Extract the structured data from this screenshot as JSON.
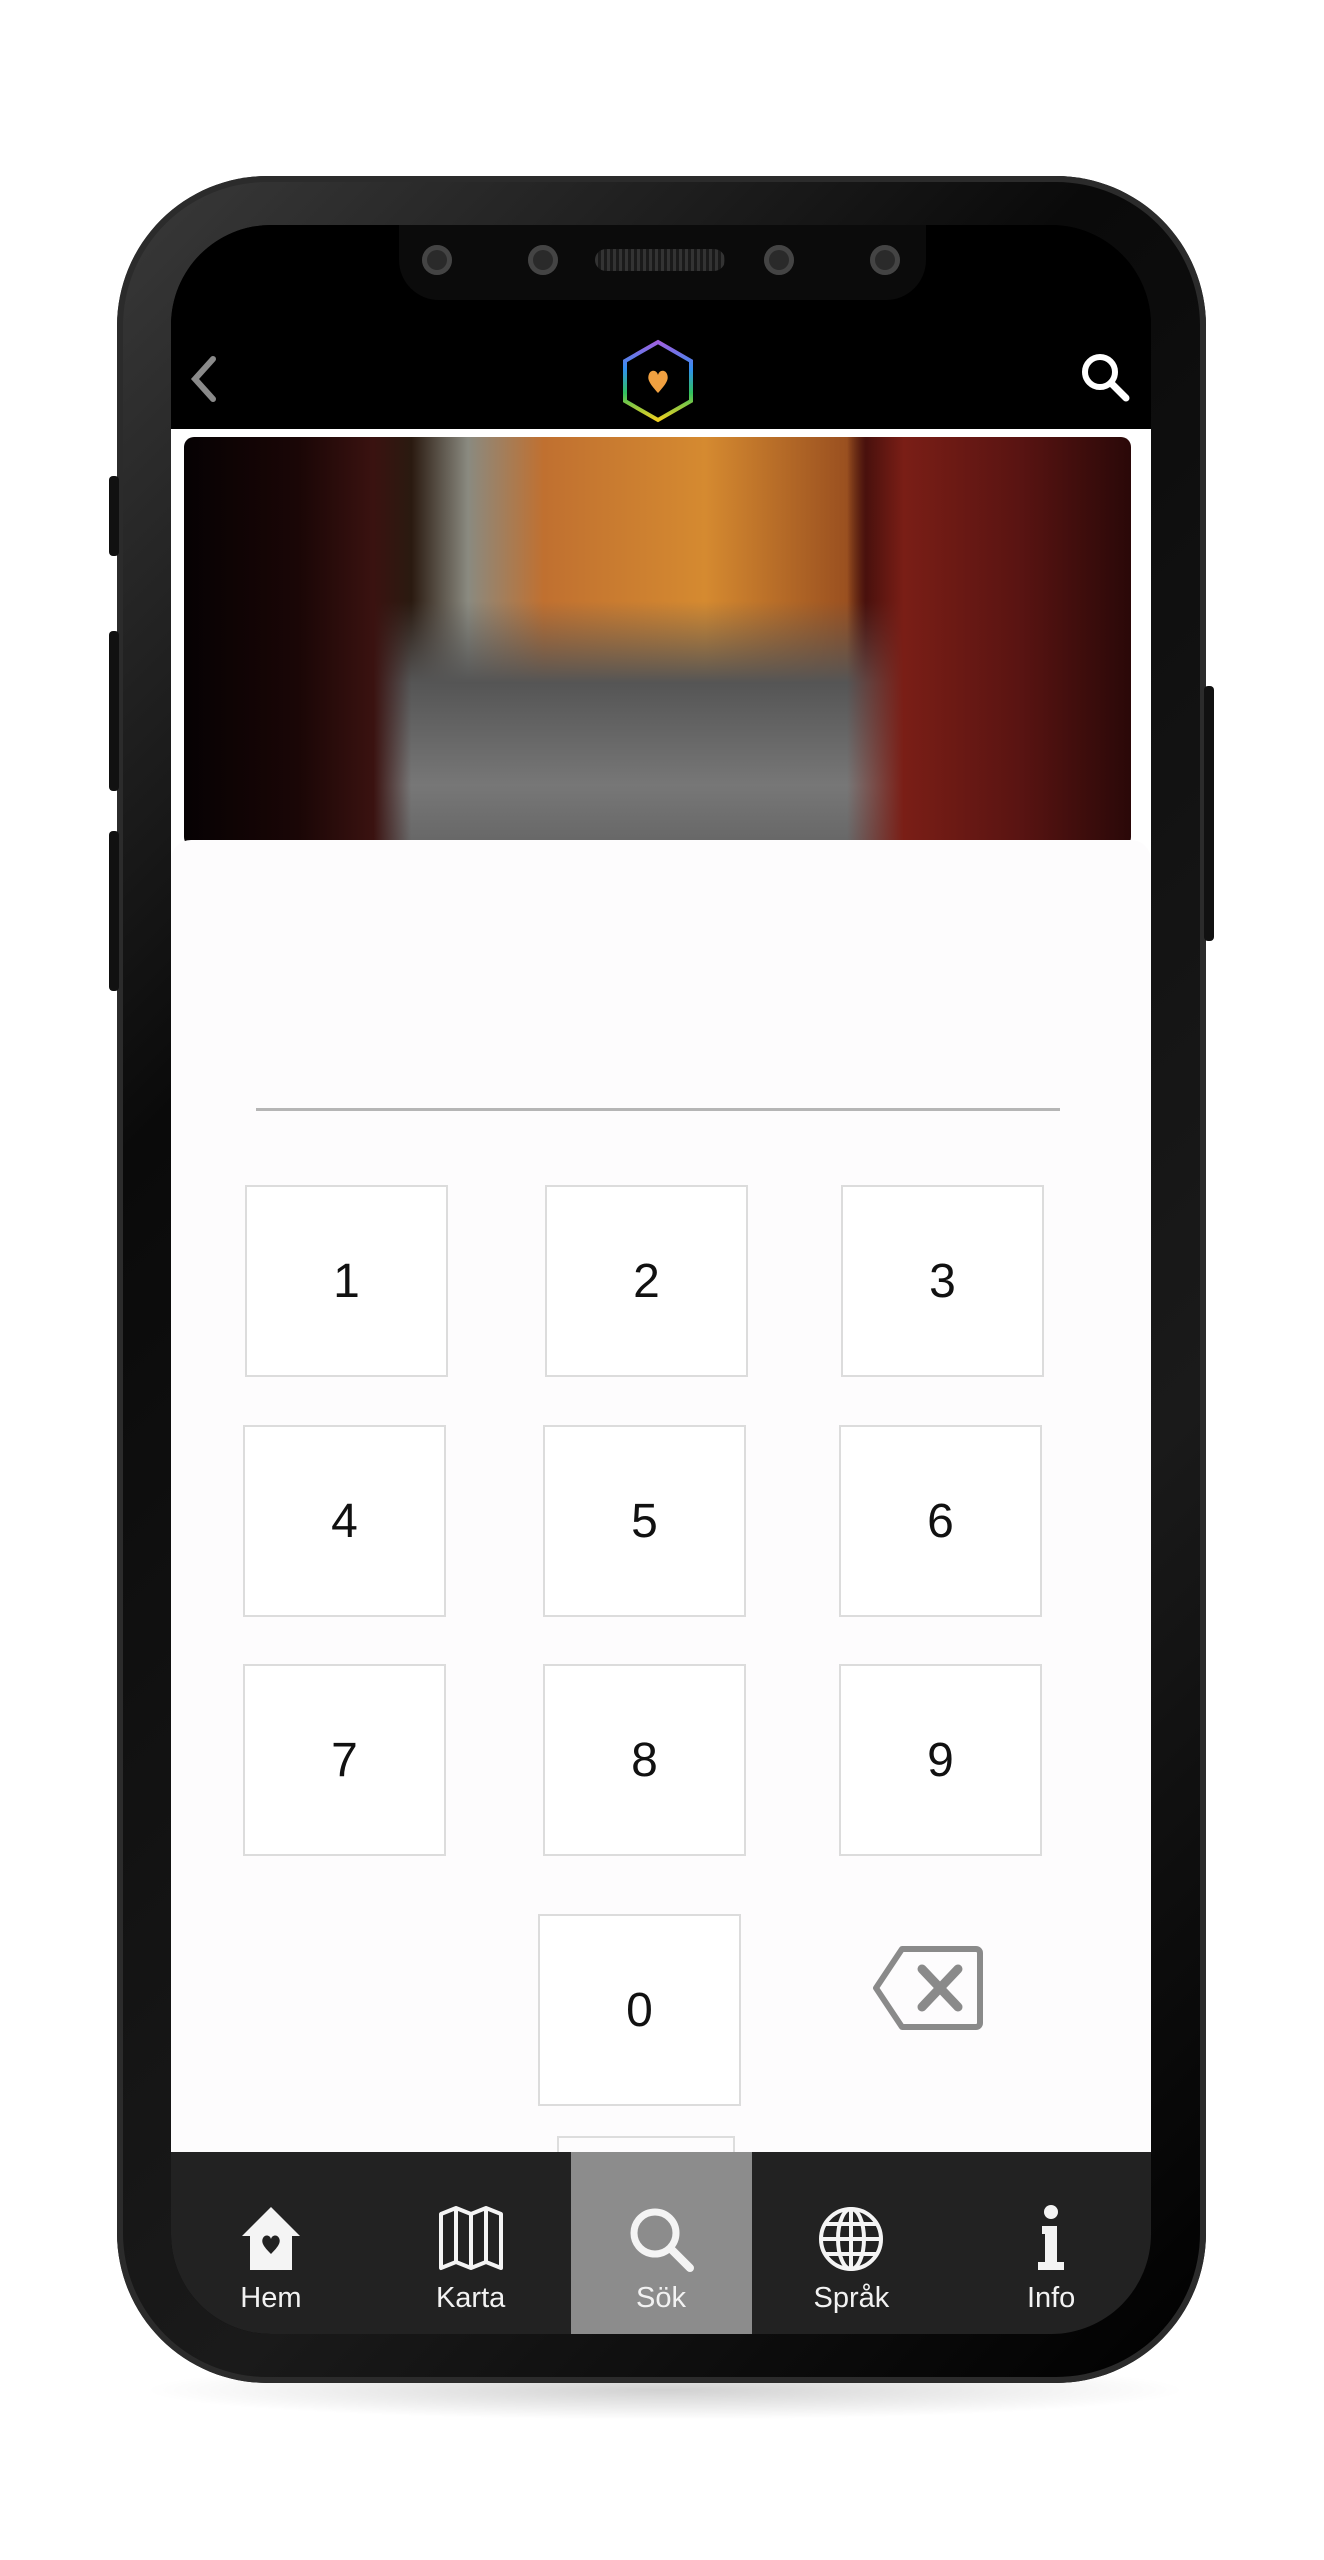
{
  "header": {
    "back_icon": "chevron-left-icon",
    "logo": "hexagon-heart-logo",
    "search_icon": "search-icon"
  },
  "photo": {
    "description_icon": "image"
  },
  "keypad": {
    "entry_value": "",
    "keys": [
      "1",
      "2",
      "3",
      "4",
      "5",
      "6",
      "7",
      "8",
      "9",
      "0"
    ],
    "backspace_icon": "backspace-icon"
  },
  "nav": {
    "active": "Sök",
    "items": [
      {
        "label": "Hem",
        "icon": "home-heart-icon"
      },
      {
        "label": "Karta",
        "icon": "map-icon"
      },
      {
        "label": "Sök",
        "icon": "search-icon"
      },
      {
        "label": "Språk",
        "icon": "globe-icon"
      },
      {
        "label": "Info",
        "icon": "info-icon"
      }
    ]
  },
  "colors": {
    "active_tab": "#8c8c8c",
    "nav_bg": "#222222",
    "logo_heart": "#f0a040"
  }
}
